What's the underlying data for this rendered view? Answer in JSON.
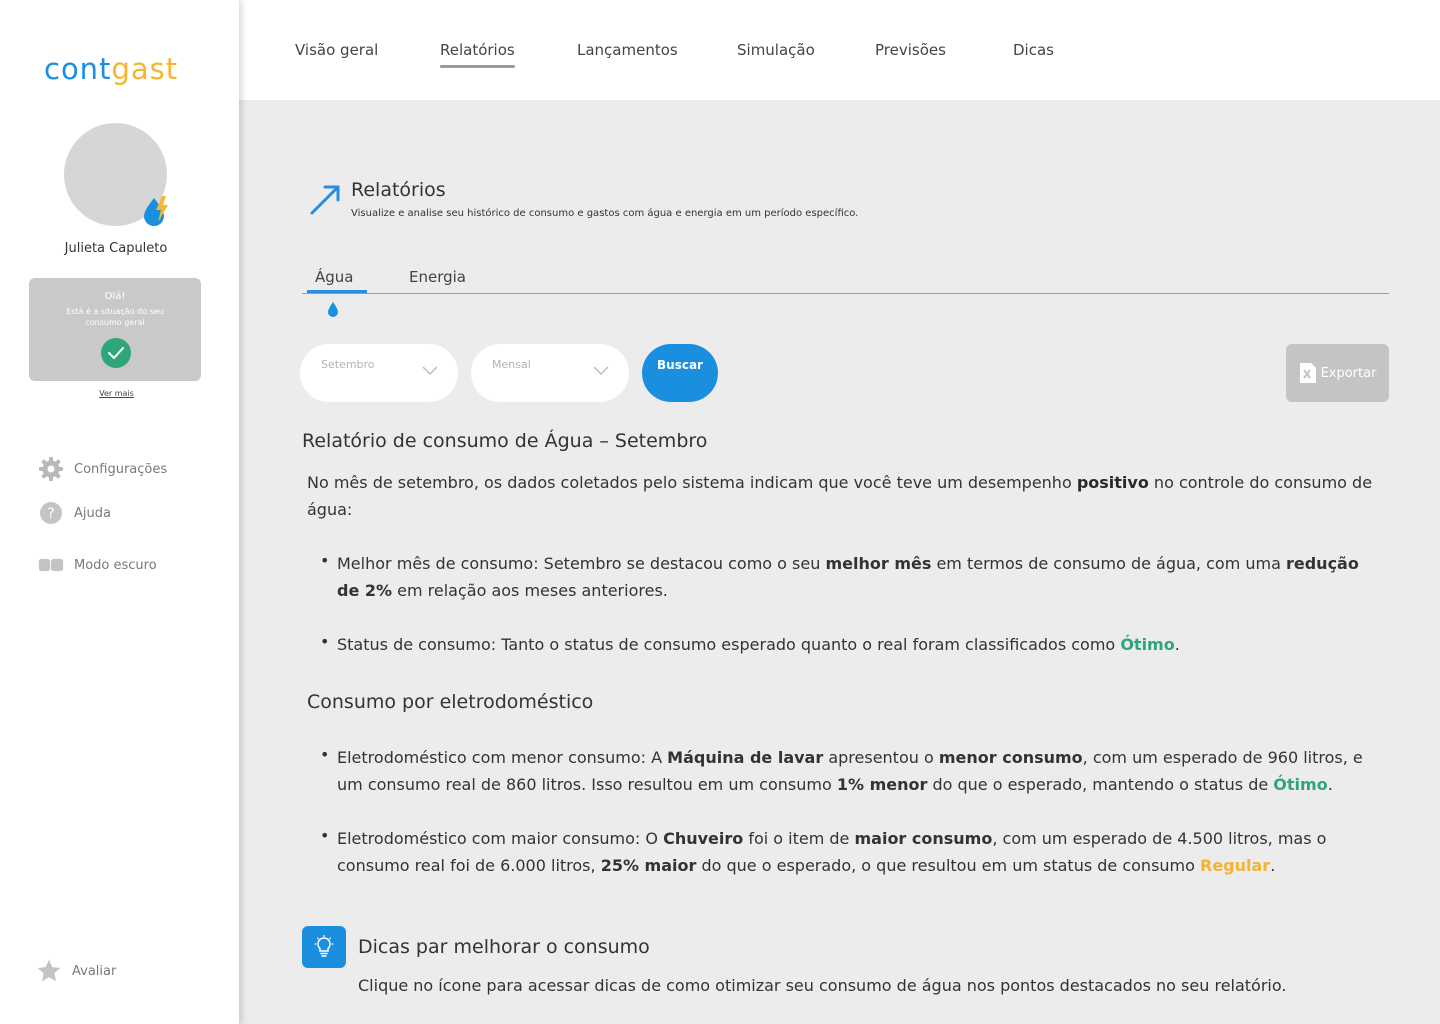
{
  "brand": {
    "part1": "cont",
    "part2": "gast",
    "color_primary": "#1a8fe0",
    "color_secondary": "#f5b731"
  },
  "user": {
    "name": "Julieta Capuleto"
  },
  "status_card": {
    "greeting": "Olá!",
    "desc": "Está é a situação do seu consumo geral",
    "see_more": "Ver mais",
    "status_icon": "check-icon"
  },
  "sidebar": {
    "items": [
      {
        "label": "Configurações",
        "icon": "gear-icon"
      },
      {
        "label": "Ajuda",
        "icon": "help-icon"
      },
      {
        "label": "Modo escuro",
        "icon": "toggle-icon"
      }
    ],
    "rate": {
      "label": "Avaliar",
      "icon": "star-icon"
    }
  },
  "nav": {
    "items": [
      "Visão geral",
      "Relatórios",
      "Lançamentos",
      "Simulação",
      "Previsões",
      "Dicas"
    ],
    "active": "Relatórios"
  },
  "page": {
    "title": "Relatórios",
    "subtitle": "Visualize e analise seu histórico de consumo e gastos com água e energia em um período específico."
  },
  "tabs": {
    "water": "Água",
    "energy": "Energia",
    "active": "Água"
  },
  "filters": {
    "month": "Setembro",
    "period": "Mensal",
    "search": "Buscar",
    "export": "Exportar"
  },
  "report": {
    "title": "Relatório de consumo de Água – Setembro",
    "intro_a": "No mês de setembro, os dados coletados pelo sistema indicam que você teve um desempenho ",
    "intro_b": "positivo",
    "intro_c": " no controle do consumo de água:",
    "b1_a": "Melhor mês de consumo: Setembro se destacou como o seu ",
    "b1_b": "melhor mês",
    "b1_c": " em termos de consumo de água, com uma ",
    "b1_d": "redução de 2%",
    "b1_e": " em relação aos meses anteriores.",
    "b2_a": "Status de consumo: Tanto o status de consumo esperado quanto o real foram classificados como ",
    "b2_b": "Ótimo",
    "b2_c": ".",
    "section_title": "Consumo por eletrodoméstico",
    "b3_a": "Eletrodoméstico com menor consumo: A ",
    "b3_b": "Máquina de lavar",
    "b3_c": " apresentou o ",
    "b3_d": "menor consumo",
    "b3_e": ", com um esperado de 960 litros, e um consumo real de 860 litros. Isso resultou em um consumo ",
    "b3_f": "1% menor",
    "b3_g": " do que o esperado, mantendo o status de ",
    "b3_h": "Ótimo",
    "b3_i": ".",
    "b4_a": "Eletrodoméstico com maior consumo: O ",
    "b4_b": "Chuveiro",
    "b4_c": " foi o item de ",
    "b4_d": "maior consumo",
    "b4_e": ", com um esperado de 4.500 litros, mas o consumo real foi de 6.000 litros, ",
    "b4_f": "25% maior",
    "b4_g": " do que o esperado, o que resultou em um status de consumo ",
    "b4_h": "Regular",
    "b4_i": "."
  },
  "tips": {
    "title": "Dicas par melhorar o consumo",
    "subtitle": "Clique no ícone para acessar dicas de como otimizar seu consumo de água nos pontos destacados no seu relatório.",
    "icon": "lightbulb-icon"
  },
  "colors": {
    "good": "#2fa57a",
    "regular": "#f2b431",
    "accent": "#1a8fe0"
  }
}
